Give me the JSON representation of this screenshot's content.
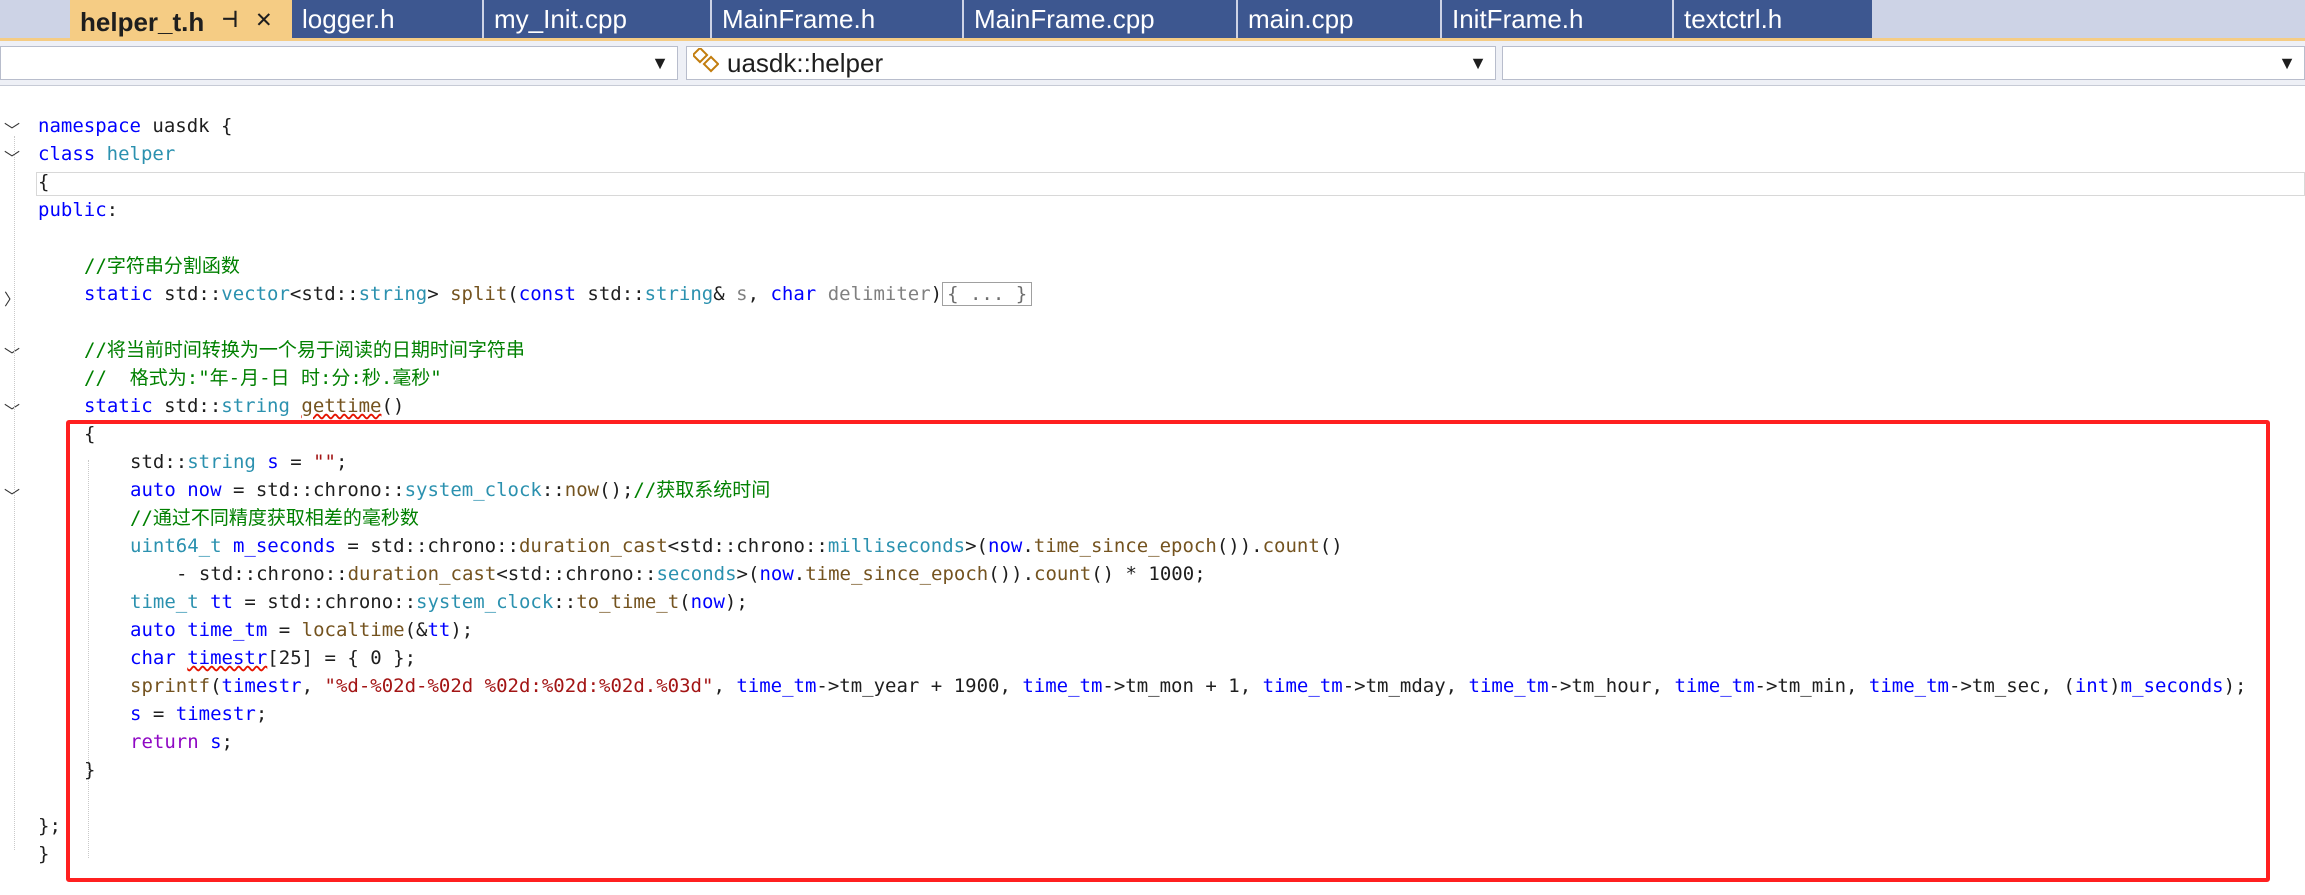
{
  "tabs": [
    {
      "label": "helper_t.h",
      "active": true
    },
    {
      "label": "logger.h"
    },
    {
      "label": "my_Init.cpp"
    },
    {
      "label": "MainFrame.h"
    },
    {
      "label": "MainFrame.cpp"
    },
    {
      "label": "main.cpp"
    },
    {
      "label": "InitFrame.h"
    },
    {
      "label": "textctrl.h"
    }
  ],
  "tab_icons": {
    "pin": "pin-icon",
    "close": "close-icon"
  },
  "navbar": {
    "project_scope": "",
    "type_scope": "uasdk::helper",
    "member_scope": ""
  },
  "code": {
    "l_namespace_kw": "namespace",
    "l_namespace_name": " uasdk {",
    "l_class_kw": "class",
    "l_class_name": " helper",
    "l_open_brace": "{",
    "l_public": "public",
    "l_public_colon": ":",
    "l_comment_split": "//字符串分割函数",
    "l_comment_time1": "//将当前时间转换为一个易于阅读的日期时间字符串",
    "l_comment_time2": "//  格式为:\"年-月-日 时:分:秒.毫秒\"",
    "l_comment_now": "//获取系统时间",
    "l_comment_diff": "//通过不同精度获取相差的毫秒数",
    "l_fmt_string": "\"%d-%02d-%02d %02d:%02d:%02d.%03d\"",
    "l_empty_string": "\"\"",
    "l_number_25": "25",
    "l_number_0": "0",
    "l_number_1000": "1000",
    "l_number_1900": "1900",
    "l_number_1": "1",
    "l_ellipsis": "{ ... }",
    "l_close_class": "};",
    "l_close_ns": "}"
  },
  "colors": {
    "highlight_border": "#ff2020",
    "active_tab": "#f5cc84",
    "inactive_tab": "#3d5790"
  }
}
